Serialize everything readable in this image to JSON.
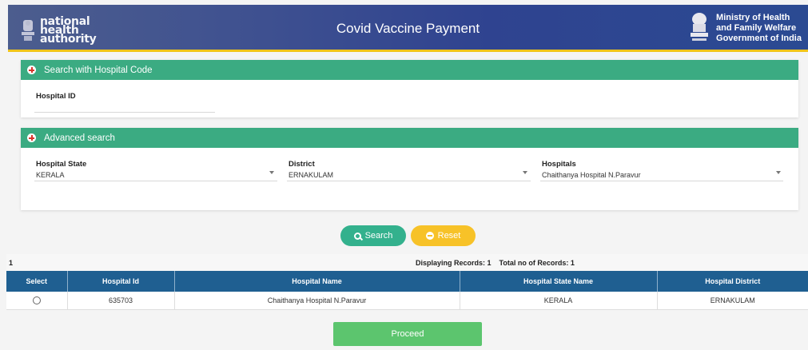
{
  "header": {
    "logo_lines": [
      "national",
      "health",
      "authority"
    ],
    "title": "Covid Vaccine Payment",
    "ministry_lines": [
      "Ministry of Health",
      "and Family Welfare",
      "Government of India"
    ]
  },
  "hospital_code_panel": {
    "title": "Search with Hospital Code",
    "hospital_id_label": "Hospital ID",
    "hospital_id_value": ""
  },
  "advanced_panel": {
    "title": "Advanced search",
    "state_label": "Hospital State",
    "state_value": "KERALA",
    "district_label": "District",
    "district_value": "ERNAKULAM",
    "hospitals_label": "Hospitals",
    "hospitals_value": "Chaithanya Hospital N.Paravur"
  },
  "actions": {
    "search_label": "Search",
    "reset_label": "Reset"
  },
  "records": {
    "page": "1",
    "info": "Displaying Records: 1    Total no of Records: 1"
  },
  "table": {
    "headers": [
      "Select",
      "Hospital Id",
      "Hospital Name",
      "Hospital State Name",
      "Hospital District"
    ],
    "rows": [
      {
        "hospital_id": "635703",
        "hospital_name": "Chaithanya Hospital N.Paravur",
        "state": "KERALA",
        "district": "ERNAKULAM"
      }
    ]
  },
  "footer": {
    "proceed_label": "Proceed"
  },
  "colors": {
    "header_bg": "#3f5190",
    "accent_yellow": "#f0c419",
    "panel_green": "#3bab82",
    "table_header": "#1f5f91",
    "proceed_green": "#5cc56e"
  }
}
